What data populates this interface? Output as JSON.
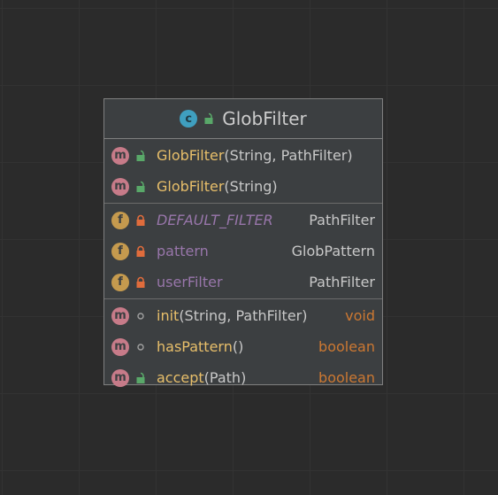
{
  "class": {
    "name": "GlobFilter",
    "kind_icon": "class-icon",
    "visibility_icon": "public-lock-icon"
  },
  "constructors": [
    {
      "name": "GlobFilter",
      "params": "(String, PathFilter)",
      "visibility": "public"
    },
    {
      "name": "GlobFilter",
      "params": "(String)",
      "visibility": "public"
    }
  ],
  "fields": [
    {
      "name": "DEFAULT_FILTER",
      "type": "PathFilter",
      "visibility": "private",
      "static": true
    },
    {
      "name": "pattern",
      "type": "GlobPattern",
      "visibility": "private",
      "static": false
    },
    {
      "name": "userFilter",
      "type": "PathFilter",
      "visibility": "private",
      "static": false
    }
  ],
  "methods": [
    {
      "name": "init",
      "params": "(String, PathFilter)",
      "type": "void",
      "visibility": "package"
    },
    {
      "name": "hasPattern",
      "params": "()",
      "type": "boolean",
      "visibility": "package"
    },
    {
      "name": "accept",
      "params": "(Path)",
      "type": "boolean",
      "visibility": "public"
    }
  ],
  "colors": {
    "method_badge": "#c77b89",
    "field_badge": "#c59a4e",
    "class_badge": "#3f9fbf",
    "public_lock": "#59a869",
    "private_lock": "#e06c3c",
    "method_name": "#e8bf6a",
    "field_name": "#9876aa",
    "primitive_type": "#cc7832"
  }
}
